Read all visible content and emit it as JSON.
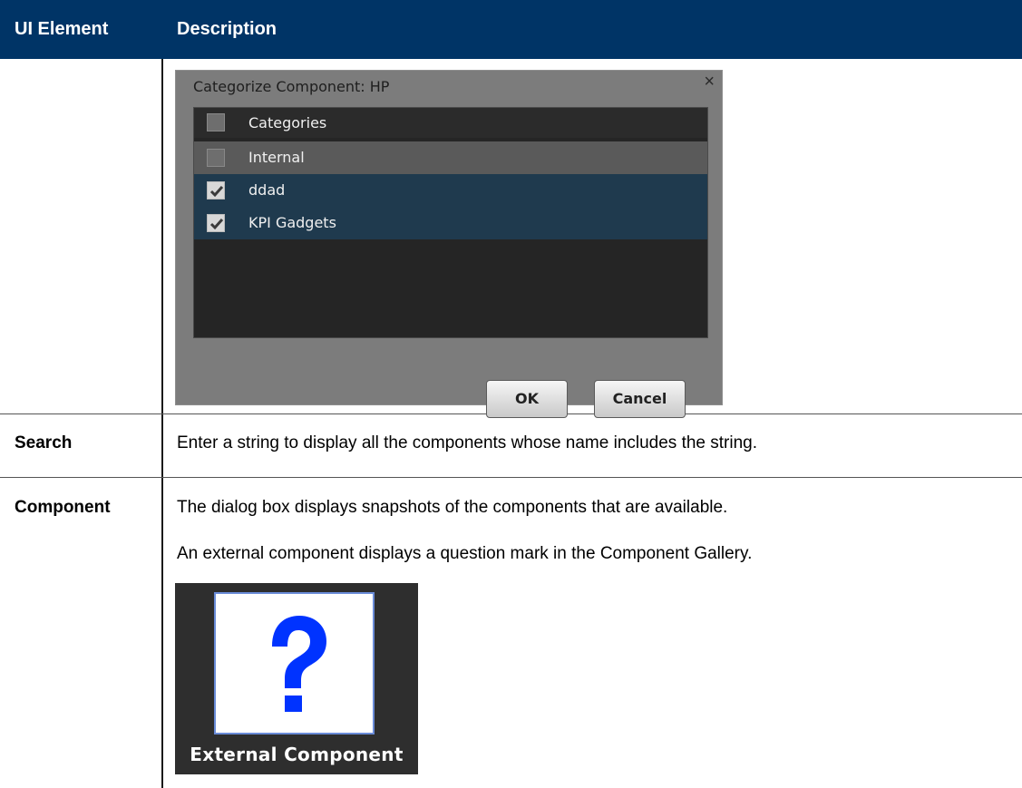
{
  "header": {
    "col1": "UI Element",
    "col2": "Description",
    "background": "#003466"
  },
  "dialog": {
    "title": "Categorize Component: HP",
    "close_glyph": "×",
    "list_header": "Categories",
    "items": [
      {
        "label": "Internal",
        "checked": false
      },
      {
        "label": "ddad",
        "checked": true
      },
      {
        "label": "KPI Gadgets",
        "checked": true
      }
    ],
    "ok_label": "OK",
    "cancel_label": "Cancel"
  },
  "rows": [
    {
      "label": "Search",
      "text": "Enter a string to display all the components whose name includes the string."
    },
    {
      "label": "Component",
      "text1": "The dialog box displays snapshots of the components that are available.",
      "text2": "An external component displays a question mark in the Component Gallery."
    }
  ],
  "external_component": {
    "label": "External Component",
    "icon": "question-mark-icon",
    "icon_color": "#0033ff"
  }
}
